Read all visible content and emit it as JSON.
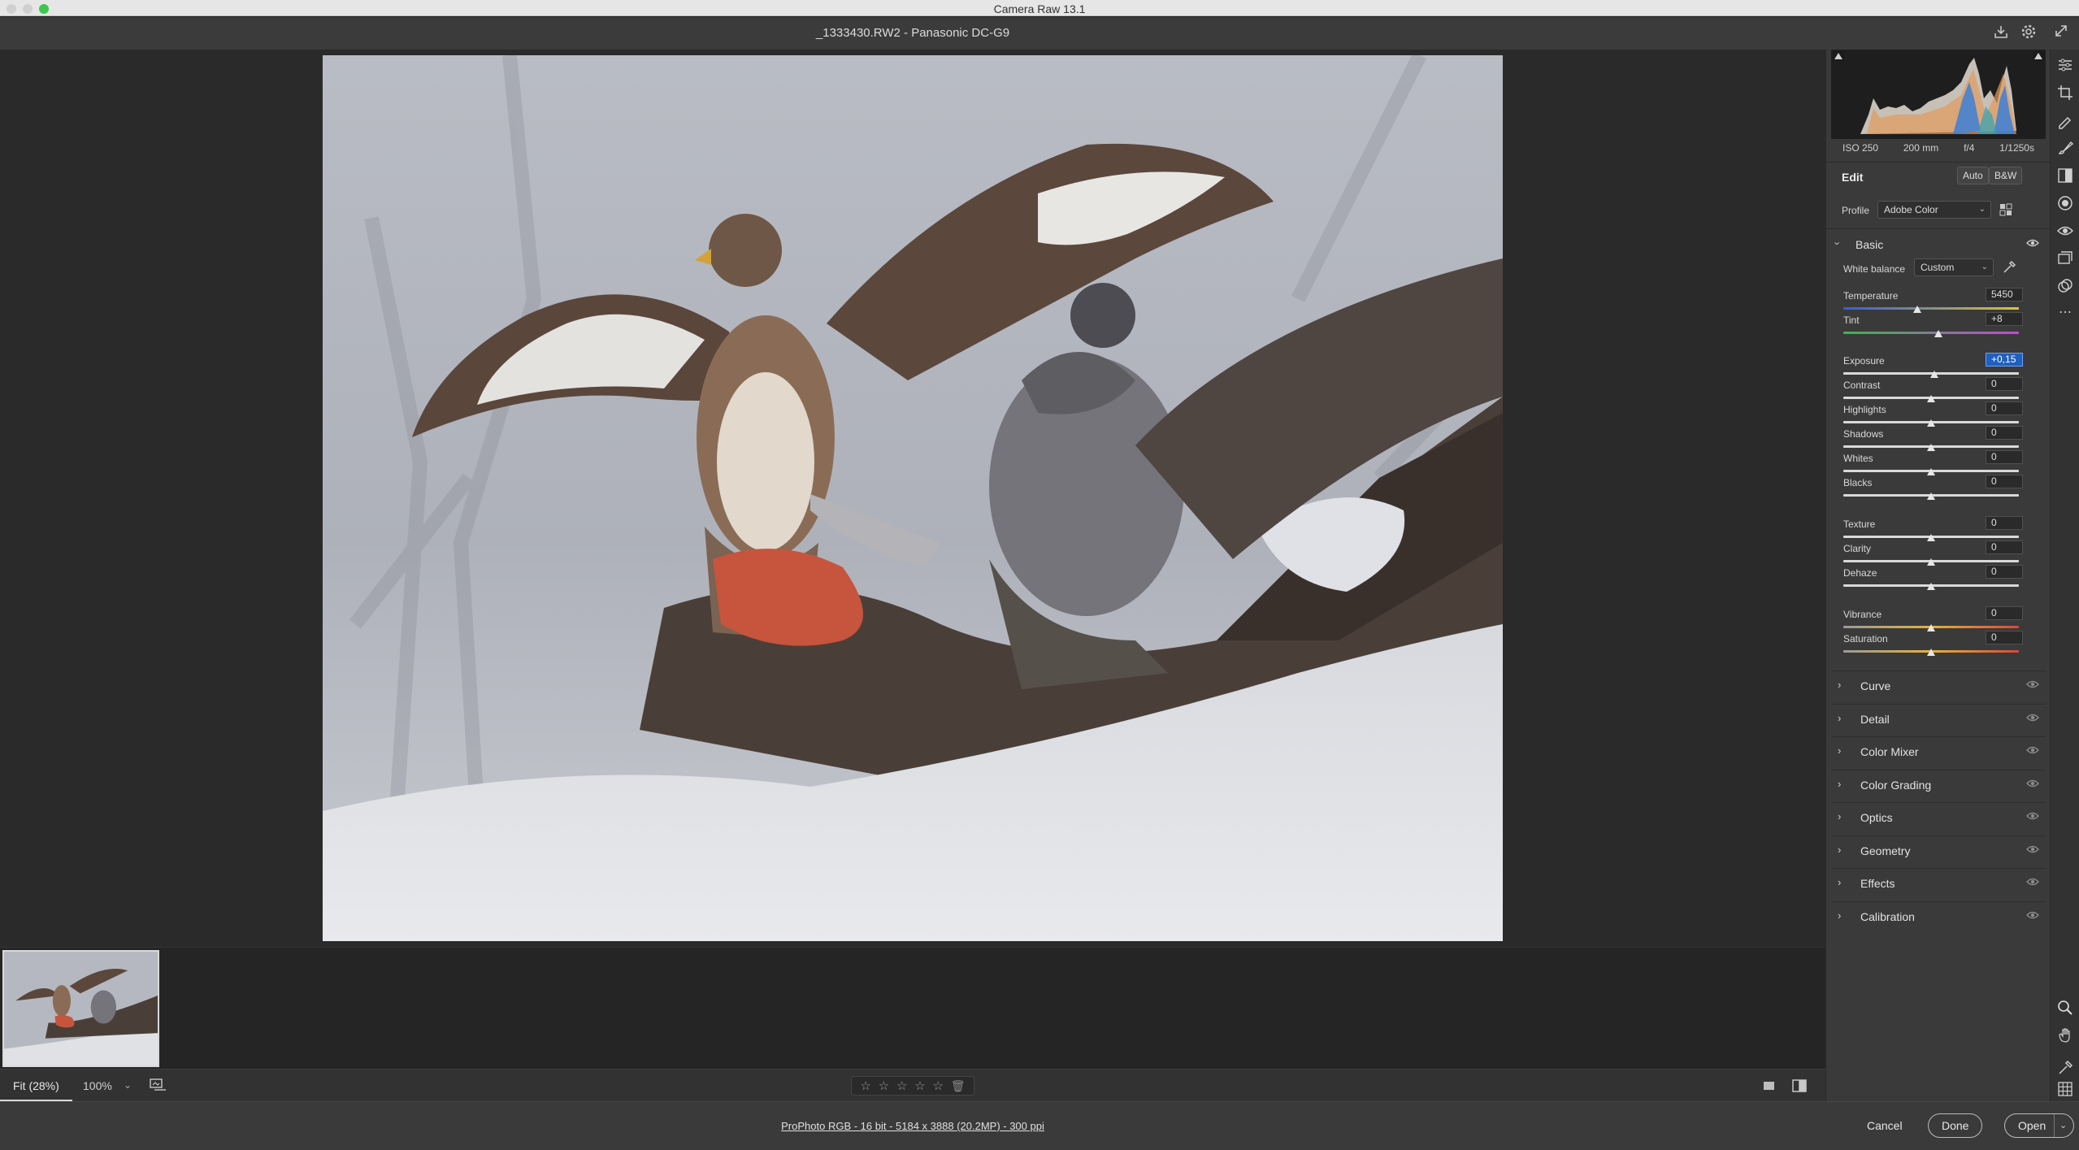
{
  "window": {
    "title": "Camera Raw 13.1"
  },
  "header": {
    "file_title": "_1333430.RW2  -  Panasonic DC-G9"
  },
  "photo": {
    "alt": ""
  },
  "exif": {
    "iso": "ISO 250",
    "focal": "200 mm",
    "aperture": "f/4",
    "shutter": "1/1250s"
  },
  "edit": {
    "title": "Edit",
    "auto_label": "Auto",
    "bw_label": "B&W",
    "profile_label": "Profile",
    "profile_value": "Adobe Color",
    "basic_title": "Basic",
    "wb_label": "White balance",
    "wb_value": "Custom"
  },
  "sliders": [
    {
      "label": "Temperature",
      "value": "5450",
      "pos": 0.42,
      "track": "temp"
    },
    {
      "label": "Tint",
      "value": "+8",
      "pos": 0.54,
      "track": "tint"
    },
    {
      "label": "Exposure",
      "value": "+0,15",
      "pos": 0.52,
      "active": true
    },
    {
      "label": "Contrast",
      "value": "0",
      "pos": 0.5
    },
    {
      "label": "Highlights",
      "value": "0",
      "pos": 0.5
    },
    {
      "label": "Shadows",
      "value": "0",
      "pos": 0.5
    },
    {
      "label": "Whites",
      "value": "0",
      "pos": 0.5
    },
    {
      "label": "Blacks",
      "value": "0",
      "pos": 0.5
    },
    {
      "label": "Texture",
      "value": "0",
      "pos": 0.5
    },
    {
      "label": "Clarity",
      "value": "0",
      "pos": 0.5
    },
    {
      "label": "Dehaze",
      "value": "0",
      "pos": 0.5
    },
    {
      "label": "Vibrance",
      "value": "0",
      "pos": 0.5,
      "track": "vib"
    },
    {
      "label": "Saturation",
      "value": "0",
      "pos": 0.5,
      "track": "sat"
    }
  ],
  "sections": [
    "Curve",
    "Detail",
    "Color Mixer",
    "Color Grading",
    "Optics",
    "Geometry",
    "Effects",
    "Calibration"
  ],
  "bottombar": {
    "fit_label": "Fit (28%)",
    "zoom_value": "100%"
  },
  "footer": {
    "workflow_link": "ProPhoto RGB - 16 bit - 5184 x 3888 (20.2MP) - 300 ppi",
    "cancel_label": "Cancel",
    "done_label": "Done",
    "open_label": "Open"
  },
  "colors": {
    "accent": "#1f5fbf",
    "panel": "#3a3a3a",
    "canvas": "#2a2a2a"
  }
}
